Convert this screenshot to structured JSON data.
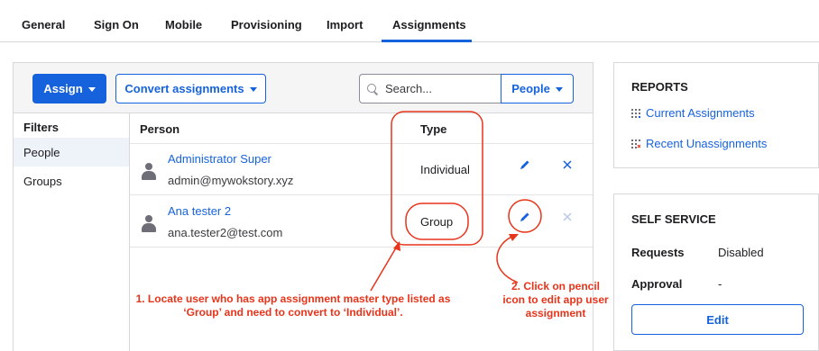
{
  "tabs": [
    {
      "label": "General"
    },
    {
      "label": "Sign On"
    },
    {
      "label": "Mobile"
    },
    {
      "label": "Provisioning"
    },
    {
      "label": "Import"
    },
    {
      "label": "Assignments",
      "active": true
    }
  ],
  "toolbar": {
    "assign_label": "Assign",
    "convert_label": "Convert assignments",
    "search_placeholder": "Search...",
    "people_label": "People"
  },
  "filters": {
    "title": "Filters",
    "items": [
      {
        "label": "People",
        "selected": true
      },
      {
        "label": "Groups",
        "selected": false
      }
    ]
  },
  "table": {
    "headers": {
      "person": "Person",
      "type": "Type"
    },
    "rows": [
      {
        "name": "Administrator Super",
        "email": "admin@mywokstory.xyz",
        "type": "Individual"
      },
      {
        "name": "Ana tester 2",
        "email": "ana.tester2@test.com",
        "type": "Group"
      }
    ]
  },
  "reports": {
    "title": "REPORTS",
    "links": [
      {
        "label": "Current Assignments",
        "icon": "report-grid-icon"
      },
      {
        "label": "Recent Unassignments",
        "icon": "report-grid-x-icon"
      }
    ]
  },
  "self_service": {
    "title": "SELF SERVICE",
    "requests_label": "Requests",
    "requests_value": "Disabled",
    "approval_label": "Approval",
    "approval_value": "-",
    "edit_label": "Edit"
  },
  "annotations": {
    "step1_line1": "1. Locate user who has app assignment master type listed as",
    "step1_line2": "‘Group’ and need to convert to ‘Individual’.",
    "step2_line1": "2. Click on pencil",
    "step2_line2": "icon to edit app user",
    "step2_line3": "assignment"
  },
  "colors": {
    "accent": "#1662dd",
    "annotation": "#e8341a",
    "border": "#d7d7dc"
  }
}
